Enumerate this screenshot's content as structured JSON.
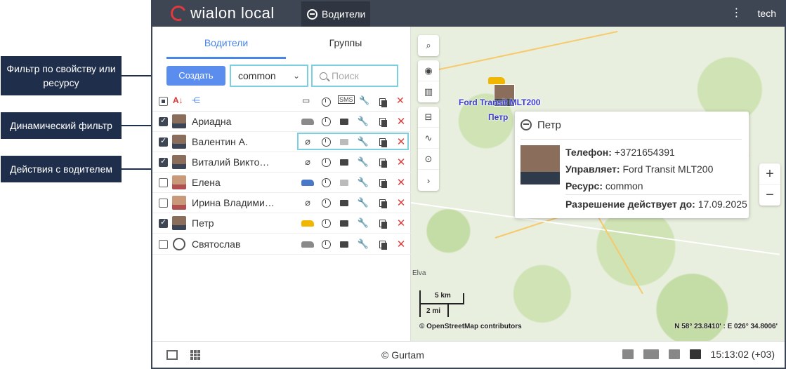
{
  "callouts": {
    "filter_property": "Фильтр по свойству или ресурсу",
    "dynamic_filter": "Динамический фильтр",
    "driver_actions": "Действия с водителем"
  },
  "topbar": {
    "logo_text": "wialon local",
    "active_tab": "Водители",
    "user": "tech"
  },
  "panel": {
    "tabs": [
      "Водители",
      "Группы"
    ],
    "create_label": "Создать",
    "filter_value": "common",
    "search_placeholder": "Поиск",
    "drivers": [
      {
        "name": "Ариадна",
        "checked": true,
        "unit": "grey-car",
        "msg": "active"
      },
      {
        "name": "Валентин А.",
        "checked": true,
        "unit": "unbound",
        "msg": "disabled"
      },
      {
        "name": "Виталий Викторович",
        "checked": true,
        "unit": "unbound",
        "msg": "active"
      },
      {
        "name": "Елена",
        "checked": false,
        "unit": "blue-car",
        "msg": "disabled"
      },
      {
        "name": "Ирина Владимировна",
        "checked": false,
        "unit": "unbound",
        "msg": "active"
      },
      {
        "name": "Петр",
        "checked": true,
        "unit": "yellow-car",
        "msg": "active"
      },
      {
        "name": "Святослав",
        "checked": false,
        "unit": "grey-car",
        "msg": "active"
      }
    ]
  },
  "map": {
    "unit_label": "Ford Transit MLT200",
    "driver_label": "Петр",
    "popup": {
      "title": "Петр",
      "phone_label": "Телефон:",
      "phone": "+3721654391",
      "unit_label": "Управляет:",
      "unit": "Ford Transit MLT200",
      "resource_label": "Ресурс:",
      "resource": "common",
      "valid_label": "Разрешение действует до:",
      "valid_until": "17.09.2025"
    },
    "scale_km": "5 km",
    "scale_mi": "2 mi",
    "attribution": "© OpenStreetMap contributors",
    "coordinates": "N 58° 23.8410' : E 026° 34.8006'",
    "place": "Elva"
  },
  "bottombar": {
    "copyright": "© Gurtam",
    "time": "15:13:02 (+03)"
  },
  "colors": {
    "accent": "#4a86e8",
    "callout": "#1f2f4b",
    "highlight": "#7ccfe0",
    "delete": "#e23b3b"
  }
}
